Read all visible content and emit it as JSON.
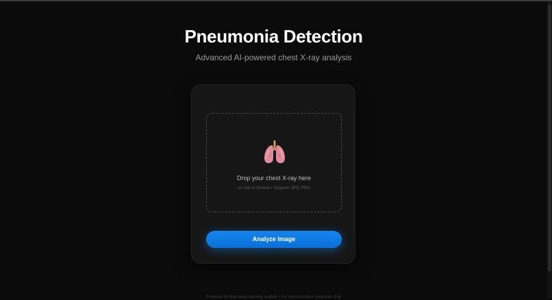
{
  "header": {
    "title": "Pneumonia Detection",
    "subtitle": "Advanced AI-powered chest X-ray analysis"
  },
  "upload": {
    "icon": "lungs-icon",
    "title": "Drop your chest X-ray here",
    "hint": "or click to browse • Supports JPG, PNG"
  },
  "actions": {
    "analyze_label": "Analyze Image"
  },
  "footer": {
    "text": "Powered by dual deep learning models • For demonstration purposes only"
  },
  "colors": {
    "background": "#0b0b0b",
    "card": "#161616",
    "accent": "#1585f0",
    "lung": "#e08a9c"
  }
}
